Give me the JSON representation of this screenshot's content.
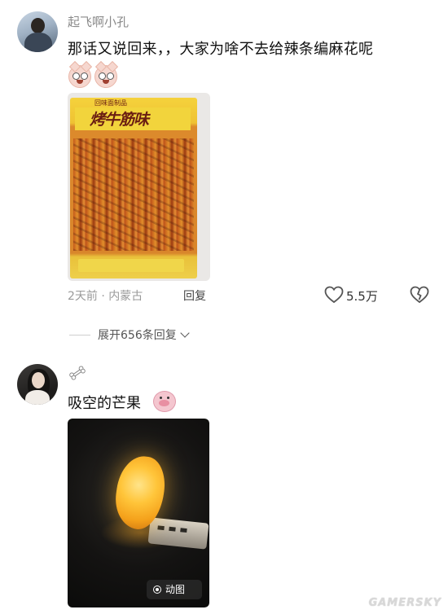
{
  "comments": [
    {
      "username": "起飞啊小孔",
      "text": "那话又说回来，，大家为啥不去给辣条编麻花呢",
      "emoji_icons": [
        "shocked-cat-emoji",
        "shocked-cat-emoji"
      ],
      "image": {
        "package_top_text": "回味面制品",
        "package_title": "烤牛筋味"
      },
      "meta": "2天前 · 内蒙古",
      "reply_label": "回复",
      "like_count": "5.5万",
      "expand_replies": "展开656条回复"
    },
    {
      "username_icon": "bone-icon",
      "text": "吸空的芒果",
      "emoji_icon": "pig-emoji",
      "image": {
        "badge": "动图"
      }
    }
  ],
  "watermark": "GAMERSKY",
  "colors": {
    "username": "#8a8a8a",
    "meta": "#9a9a9a",
    "mango": "#ffc53a"
  }
}
